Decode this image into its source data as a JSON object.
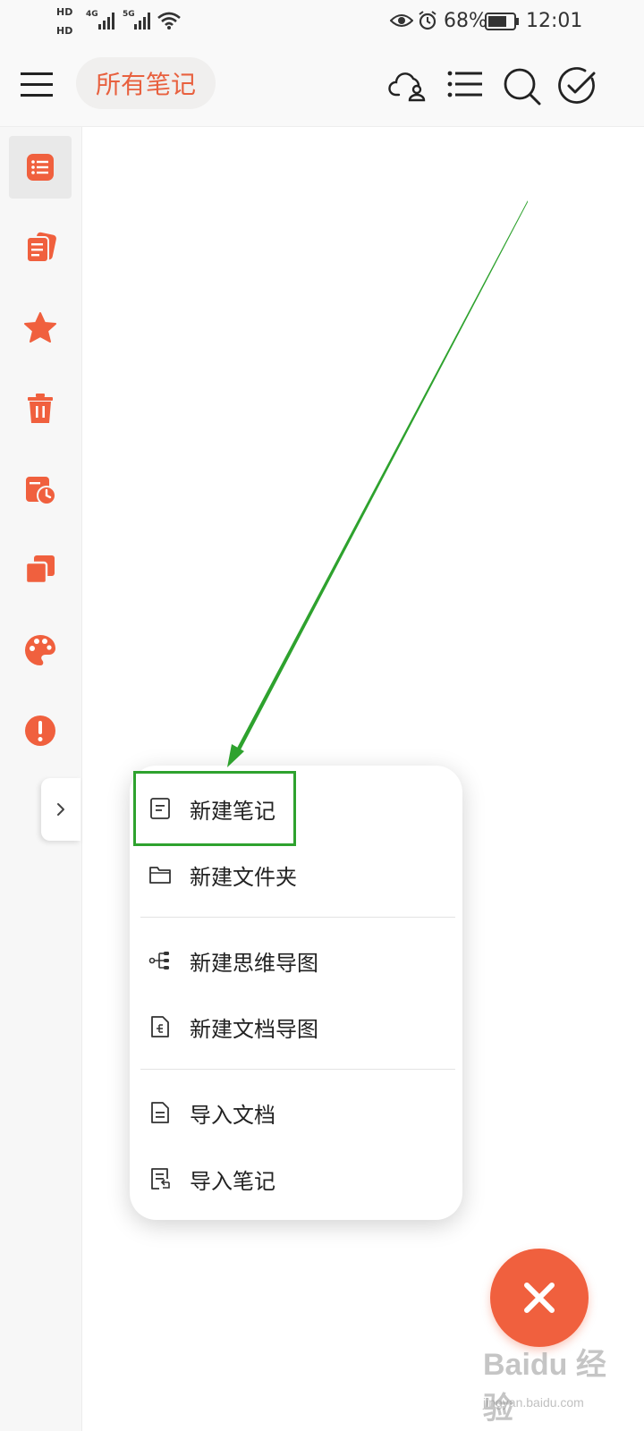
{
  "status_bar": {
    "hd1": "HD",
    "hd2": "HD",
    "net1": "4G",
    "net2": "5G",
    "battery": "68%",
    "time": "12:01"
  },
  "header": {
    "title": "所有笔记"
  },
  "sidebar": {
    "items": [
      {
        "name": "all-notes",
        "icon": "list-icon"
      },
      {
        "name": "notebooks",
        "icon": "notebook-icon"
      },
      {
        "name": "starred",
        "icon": "star-icon"
      },
      {
        "name": "trash",
        "icon": "trash-icon"
      },
      {
        "name": "reminders",
        "icon": "calendar-clock-icon"
      },
      {
        "name": "templates",
        "icon": "copy-icon"
      },
      {
        "name": "theme",
        "icon": "palette-icon"
      },
      {
        "name": "feedback",
        "icon": "exclamation-icon"
      }
    ],
    "accent": "#f0603e"
  },
  "menu": {
    "items": [
      {
        "label": "新建笔记",
        "icon": "note-icon"
      },
      {
        "label": "新建文件夹",
        "icon": "folder-icon"
      },
      {
        "label": "新建思维导图",
        "icon": "mindmap-icon"
      },
      {
        "label": "新建文档导图",
        "icon": "doc-map-icon"
      },
      {
        "label": "导入文档",
        "icon": "import-doc-icon"
      },
      {
        "label": "导入笔记",
        "icon": "import-note-icon"
      }
    ]
  },
  "annotation": {
    "highlight_color": "#2ea22e"
  },
  "watermark": {
    "main": "Baidu 经验",
    "sub": "jingyan.baidu.com"
  }
}
